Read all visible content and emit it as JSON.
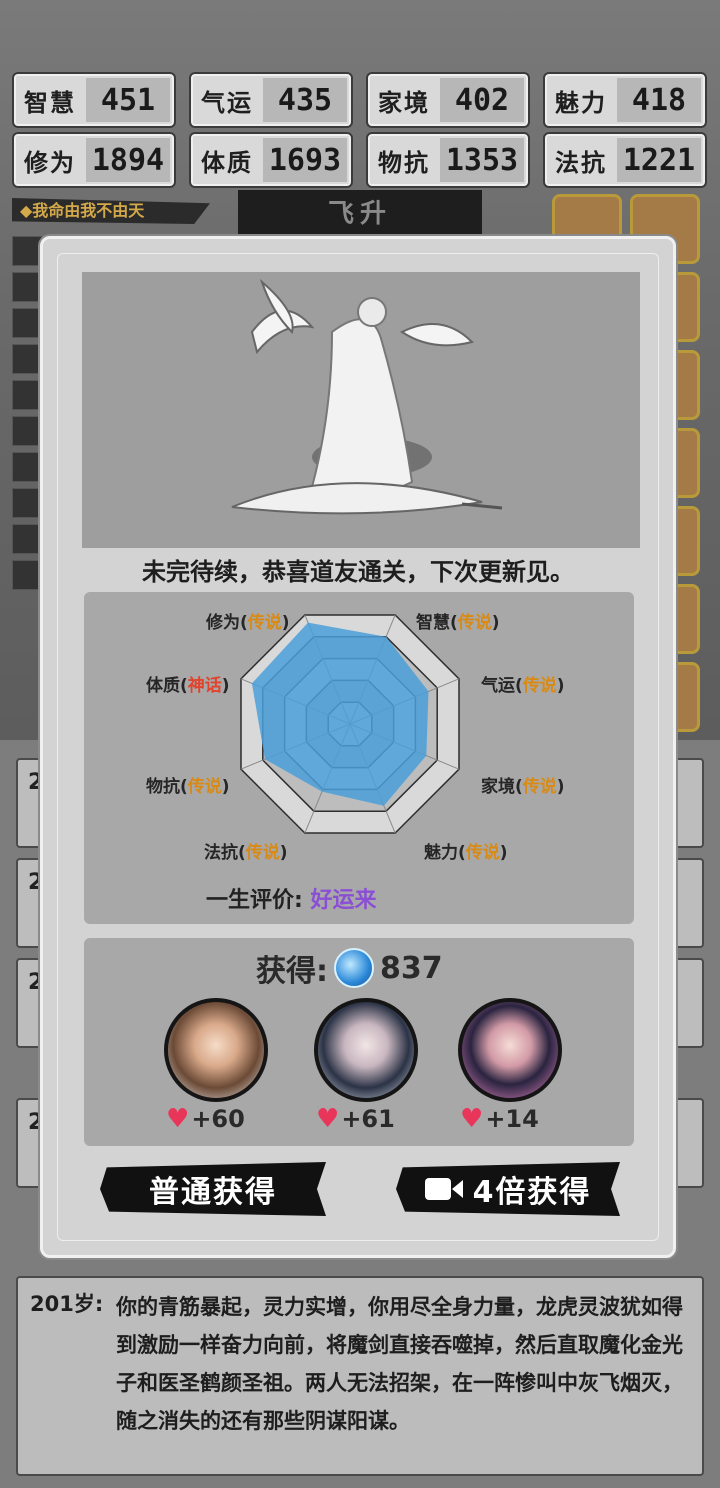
{
  "stats": [
    {
      "label": "智慧",
      "value": "451"
    },
    {
      "label": "气运",
      "value": "435"
    },
    {
      "label": "家境",
      "value": "402"
    },
    {
      "label": "魅力",
      "value": "418"
    },
    {
      "label": "修为",
      "value": "1894"
    },
    {
      "label": "体质",
      "value": "1693"
    },
    {
      "label": "物抗",
      "value": "1353"
    },
    {
      "label": "法抗",
      "value": "1221"
    }
  ],
  "motto": "◆我命由我不由天",
  "ascend_tab": "飞升",
  "log_numbers": [
    "2",
    "2",
    "2",
    "2"
  ],
  "modal": {
    "headline": "未完待续，恭喜道友通关，下次更新见。",
    "radar": {
      "labels": [
        {
          "name": "修为",
          "tier": "传说"
        },
        {
          "name": "智慧",
          "tier": "传说"
        },
        {
          "name": "气运",
          "tier": "传说"
        },
        {
          "name": "家境",
          "tier": "传说"
        },
        {
          "name": "魅力",
          "tier": "传说"
        },
        {
          "name": "法抗",
          "tier": "传说"
        },
        {
          "name": "物抗",
          "tier": "传说"
        },
        {
          "name": "体质",
          "tier": "神话"
        }
      ],
      "open_paren": "(",
      "close_paren": ")"
    },
    "evaluation_label": "一生评价:",
    "evaluation_value": "好运来",
    "gain_label": "获得:",
    "gain_value": "837",
    "rewards": [
      {
        "value": "+60"
      },
      {
        "value": "+61"
      },
      {
        "value": "+14"
      }
    ],
    "btn_normal": "普通获得",
    "btn_video": "4倍获得"
  },
  "story": {
    "age": "201岁:",
    "text": "你的青筋暴起，灵力实增，你用尽全身力量，龙虎灵波犹如得到激励一样奋力向前，将魔剑直接吞噬掉，然后直取魔化金光子和医圣鹤颜圣祖。两人无法招架，在一阵惨叫中灰飞烟灭，随之消失的还有那些阴谋阳谋。"
  },
  "chart_data": {
    "type": "radar",
    "categories": [
      "修为",
      "智慧",
      "气运",
      "家境",
      "魅力",
      "法抗",
      "物抗",
      "体质"
    ],
    "values": [
      0.93,
      0.8,
      0.72,
      0.7,
      0.75,
      0.62,
      0.78,
      0.9
    ],
    "colors": {
      "fill": "#4a9fd8",
      "grid": "#2e2e2e",
      "tier_legend": "#d98a14",
      "tier_myth": "#e2432c",
      "eval": "#8b4fd6"
    }
  }
}
